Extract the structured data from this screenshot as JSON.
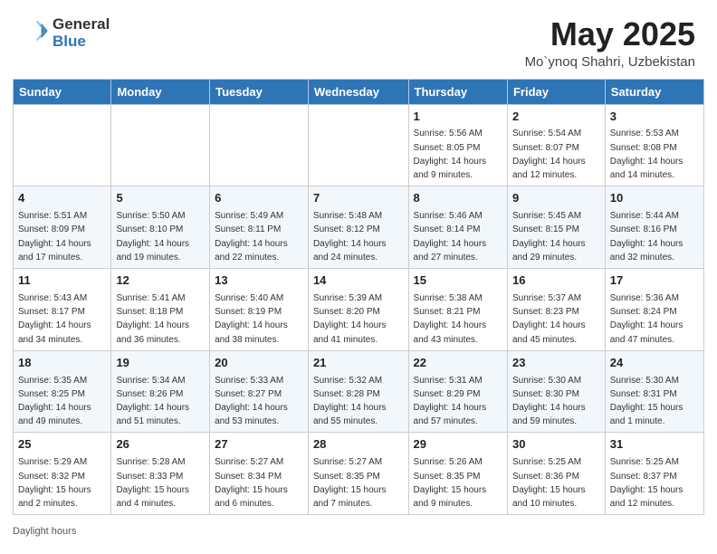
{
  "header": {
    "logo_line1": "General",
    "logo_line2": "Blue",
    "month_title": "May 2025",
    "location": "Mo`ynoq Shahri, Uzbekistan"
  },
  "days_of_week": [
    "Sunday",
    "Monday",
    "Tuesday",
    "Wednesday",
    "Thursday",
    "Friday",
    "Saturday"
  ],
  "weeks": [
    [
      {
        "day": "",
        "info": ""
      },
      {
        "day": "",
        "info": ""
      },
      {
        "day": "",
        "info": ""
      },
      {
        "day": "",
        "info": ""
      },
      {
        "day": "1",
        "info": "Sunrise: 5:56 AM\nSunset: 8:05 PM\nDaylight: 14 hours and 9 minutes."
      },
      {
        "day": "2",
        "info": "Sunrise: 5:54 AM\nSunset: 8:07 PM\nDaylight: 14 hours and 12 minutes."
      },
      {
        "day": "3",
        "info": "Sunrise: 5:53 AM\nSunset: 8:08 PM\nDaylight: 14 hours and 14 minutes."
      }
    ],
    [
      {
        "day": "4",
        "info": "Sunrise: 5:51 AM\nSunset: 8:09 PM\nDaylight: 14 hours and 17 minutes."
      },
      {
        "day": "5",
        "info": "Sunrise: 5:50 AM\nSunset: 8:10 PM\nDaylight: 14 hours and 19 minutes."
      },
      {
        "day": "6",
        "info": "Sunrise: 5:49 AM\nSunset: 8:11 PM\nDaylight: 14 hours and 22 minutes."
      },
      {
        "day": "7",
        "info": "Sunrise: 5:48 AM\nSunset: 8:12 PM\nDaylight: 14 hours and 24 minutes."
      },
      {
        "day": "8",
        "info": "Sunrise: 5:46 AM\nSunset: 8:14 PM\nDaylight: 14 hours and 27 minutes."
      },
      {
        "day": "9",
        "info": "Sunrise: 5:45 AM\nSunset: 8:15 PM\nDaylight: 14 hours and 29 minutes."
      },
      {
        "day": "10",
        "info": "Sunrise: 5:44 AM\nSunset: 8:16 PM\nDaylight: 14 hours and 32 minutes."
      }
    ],
    [
      {
        "day": "11",
        "info": "Sunrise: 5:43 AM\nSunset: 8:17 PM\nDaylight: 14 hours and 34 minutes."
      },
      {
        "day": "12",
        "info": "Sunrise: 5:41 AM\nSunset: 8:18 PM\nDaylight: 14 hours and 36 minutes."
      },
      {
        "day": "13",
        "info": "Sunrise: 5:40 AM\nSunset: 8:19 PM\nDaylight: 14 hours and 38 minutes."
      },
      {
        "day": "14",
        "info": "Sunrise: 5:39 AM\nSunset: 8:20 PM\nDaylight: 14 hours and 41 minutes."
      },
      {
        "day": "15",
        "info": "Sunrise: 5:38 AM\nSunset: 8:21 PM\nDaylight: 14 hours and 43 minutes."
      },
      {
        "day": "16",
        "info": "Sunrise: 5:37 AM\nSunset: 8:23 PM\nDaylight: 14 hours and 45 minutes."
      },
      {
        "day": "17",
        "info": "Sunrise: 5:36 AM\nSunset: 8:24 PM\nDaylight: 14 hours and 47 minutes."
      }
    ],
    [
      {
        "day": "18",
        "info": "Sunrise: 5:35 AM\nSunset: 8:25 PM\nDaylight: 14 hours and 49 minutes."
      },
      {
        "day": "19",
        "info": "Sunrise: 5:34 AM\nSunset: 8:26 PM\nDaylight: 14 hours and 51 minutes."
      },
      {
        "day": "20",
        "info": "Sunrise: 5:33 AM\nSunset: 8:27 PM\nDaylight: 14 hours and 53 minutes."
      },
      {
        "day": "21",
        "info": "Sunrise: 5:32 AM\nSunset: 8:28 PM\nDaylight: 14 hours and 55 minutes."
      },
      {
        "day": "22",
        "info": "Sunrise: 5:31 AM\nSunset: 8:29 PM\nDaylight: 14 hours and 57 minutes."
      },
      {
        "day": "23",
        "info": "Sunrise: 5:30 AM\nSunset: 8:30 PM\nDaylight: 14 hours and 59 minutes."
      },
      {
        "day": "24",
        "info": "Sunrise: 5:30 AM\nSunset: 8:31 PM\nDaylight: 15 hours and 1 minute."
      }
    ],
    [
      {
        "day": "25",
        "info": "Sunrise: 5:29 AM\nSunset: 8:32 PM\nDaylight: 15 hours and 2 minutes."
      },
      {
        "day": "26",
        "info": "Sunrise: 5:28 AM\nSunset: 8:33 PM\nDaylight: 15 hours and 4 minutes."
      },
      {
        "day": "27",
        "info": "Sunrise: 5:27 AM\nSunset: 8:34 PM\nDaylight: 15 hours and 6 minutes."
      },
      {
        "day": "28",
        "info": "Sunrise: 5:27 AM\nSunset: 8:35 PM\nDaylight: 15 hours and 7 minutes."
      },
      {
        "day": "29",
        "info": "Sunrise: 5:26 AM\nSunset: 8:35 PM\nDaylight: 15 hours and 9 minutes."
      },
      {
        "day": "30",
        "info": "Sunrise: 5:25 AM\nSunset: 8:36 PM\nDaylight: 15 hours and 10 minutes."
      },
      {
        "day": "31",
        "info": "Sunrise: 5:25 AM\nSunset: 8:37 PM\nDaylight: 15 hours and 12 minutes."
      }
    ]
  ],
  "footer": {
    "note": "Daylight hours"
  },
  "colors": {
    "header_bg": "#2e75b6",
    "header_text": "#ffffff",
    "accent": "#1a6faf"
  }
}
